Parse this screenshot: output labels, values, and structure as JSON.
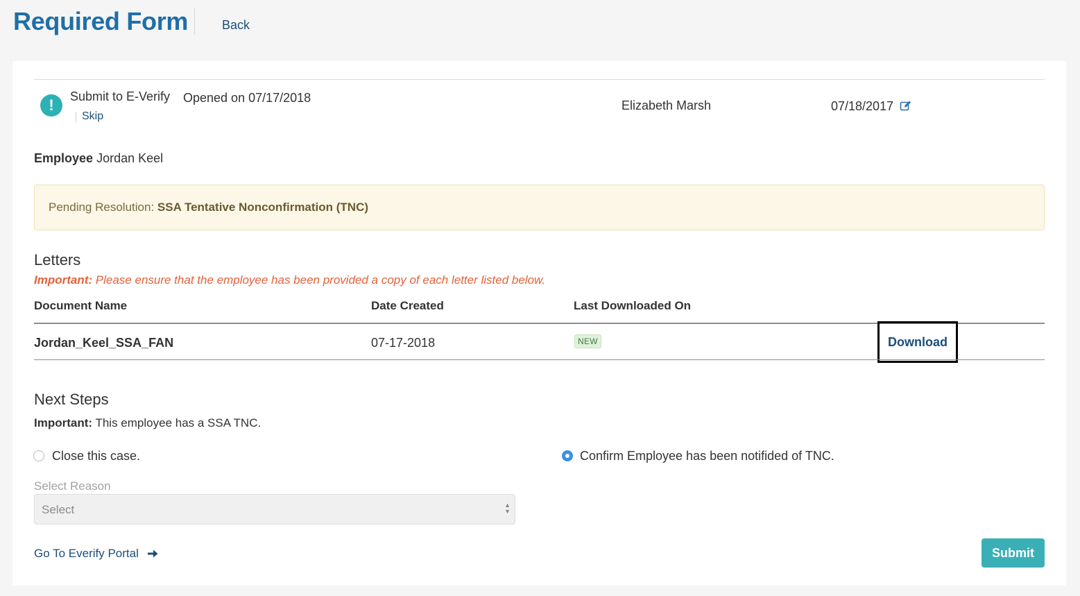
{
  "header": {
    "title": "Required Form",
    "back_label": "Back"
  },
  "task": {
    "icon": "exclamation-icon",
    "title": "Submit to E-Verify",
    "skip_label": "Skip",
    "opened_on": "Opened on 07/17/2018",
    "assignee": "Elizabeth Marsh",
    "due_date": "07/18/2017"
  },
  "employee": {
    "label": "Employee",
    "name": "Jordan Keel"
  },
  "alert": {
    "prefix": "Pending Resolution:",
    "status": "SSA Tentative Nonconfirmation (TNC)",
    "background": "#fcf7e6"
  },
  "letters": {
    "title": "Letters",
    "important_label": "Important:",
    "important_text": "Please ensure that the employee has been provided a copy of each letter listed below.",
    "columns": [
      "Document Name",
      "Date Created",
      "Last Downloaded On"
    ],
    "rows": [
      {
        "name": "Jordan_Keel_SSA_FAN",
        "date_created": "07-17-2018",
        "last_downloaded": "NEW",
        "action": "Download"
      }
    ]
  },
  "next_steps": {
    "title": "Next Steps",
    "important_label": "Important:",
    "important_text": "This employee has a SSA TNC.",
    "options": [
      {
        "label": "Close this case.",
        "selected": false
      },
      {
        "label": "Confirm Employee has been notifided of TNC.",
        "selected": true
      }
    ],
    "select_label": "Select Reason",
    "select_value": "Select"
  },
  "footer": {
    "portal_link": "Go To Everify Portal",
    "submit_label": "Submit"
  },
  "colors": {
    "brand_blue": "#1f6fa7",
    "link_blue": "#1b4f7a",
    "teal": "#3ab0b6",
    "important_orange": "#e2623b",
    "radio_blue": "#3d8fe3"
  }
}
